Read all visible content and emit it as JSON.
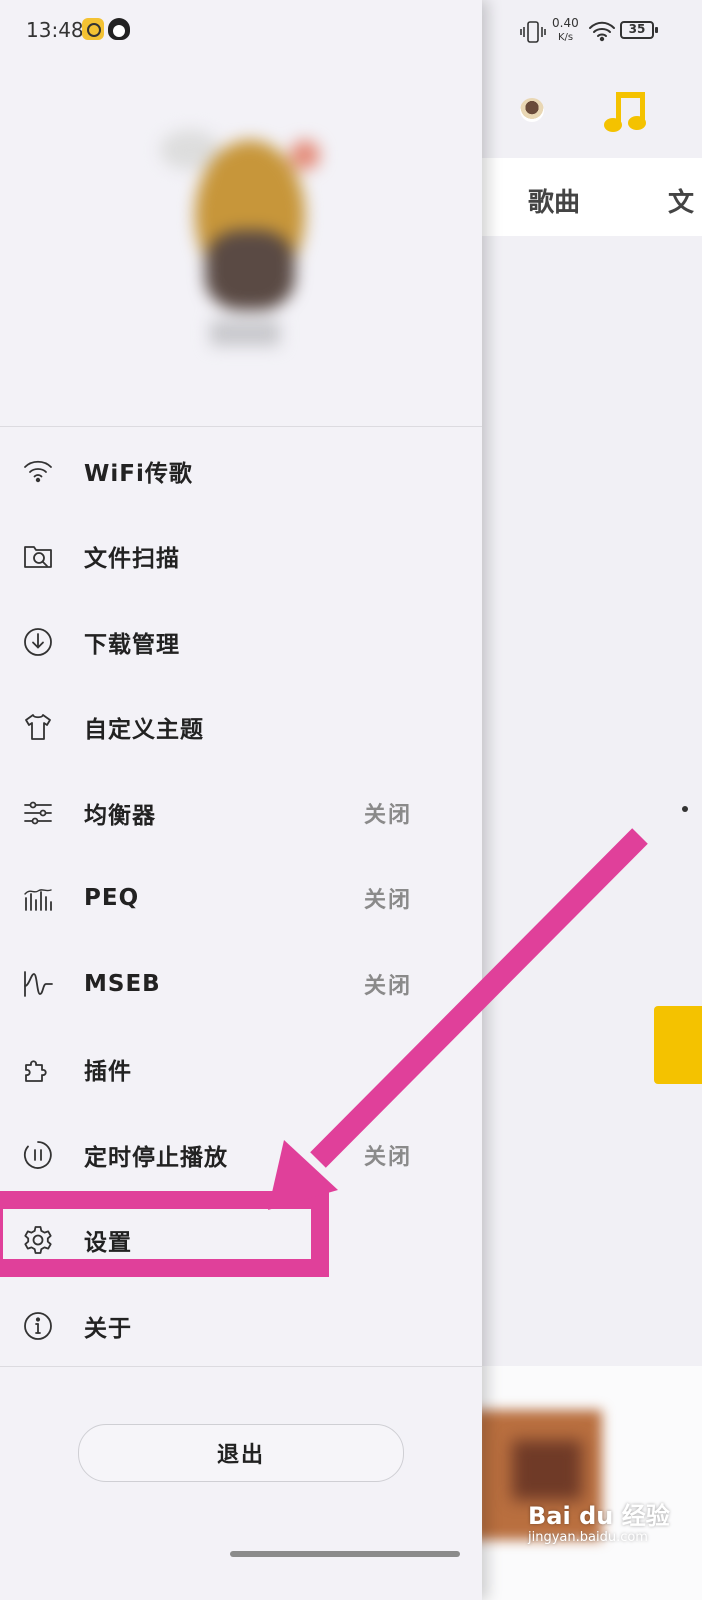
{
  "status_bar": {
    "time": "13:48",
    "net_speed": "0.40",
    "net_unit": "K/s",
    "battery": "35"
  },
  "drawer": {
    "menu": [
      {
        "icon": "wifi-icon",
        "label": "WiFi传歌",
        "status": ""
      },
      {
        "icon": "file-scan-icon",
        "label": "文件扫描",
        "status": ""
      },
      {
        "icon": "download-icon",
        "label": "下载管理",
        "status": ""
      },
      {
        "icon": "tshirt-icon",
        "label": "自定义主题",
        "status": ""
      },
      {
        "icon": "equalizer-icon",
        "label": "均衡器",
        "status": "关闭"
      },
      {
        "icon": "peq-icon",
        "label": "PEQ",
        "status": "关闭"
      },
      {
        "icon": "mseb-icon",
        "label": "MSEB",
        "status": "关闭"
      },
      {
        "icon": "plugin-icon",
        "label": "插件",
        "status": ""
      },
      {
        "icon": "timer-icon",
        "label": "定时停止播放",
        "status": "关闭"
      },
      {
        "icon": "gear-icon",
        "label": "设置",
        "status": ""
      },
      {
        "icon": "info-icon",
        "label": "关于",
        "status": ""
      }
    ],
    "logout_label": "退出"
  },
  "right_pane": {
    "tab_songs": "歌曲",
    "tab_partial": "文"
  },
  "watermark": {
    "text": "Bai du 经验",
    "sub": "jingyan.baidu.com"
  },
  "colors": {
    "annotation": "#e0409a",
    "accent": "#f4c200"
  }
}
